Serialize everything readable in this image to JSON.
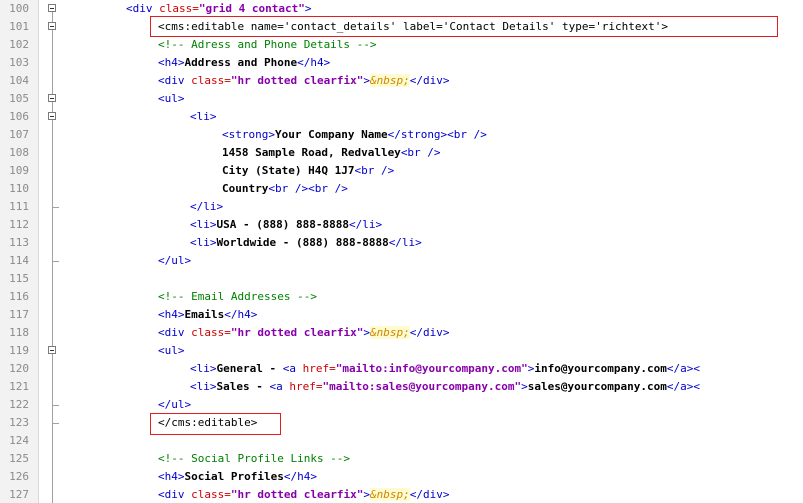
{
  "editor": {
    "lines": [
      {
        "num": "100",
        "indent": 0,
        "fold": "open",
        "parts": [
          {
            "t": "tag",
            "v": "<div "
          },
          {
            "t": "attr",
            "v": "class="
          },
          {
            "t": "val",
            "v": "\"grid 4 contact\""
          },
          {
            "t": "tag",
            "v": ">"
          }
        ]
      },
      {
        "num": "101",
        "indent": 1,
        "fold": "open",
        "parts": [
          {
            "t": "plain",
            "v": "<cms:editable name='contact_details' label='Contact Details' type='richtext'>"
          }
        ]
      },
      {
        "num": "102",
        "indent": 1,
        "parts": [
          {
            "t": "com",
            "v": "<!-- Adress and Phone Details -->"
          }
        ]
      },
      {
        "num": "103",
        "indent": 1,
        "parts": [
          {
            "t": "tag",
            "v": "<h4>"
          },
          {
            "t": "txt",
            "v": "Address and Phone"
          },
          {
            "t": "tag",
            "v": "</h4>"
          }
        ]
      },
      {
        "num": "104",
        "indent": 1,
        "parts": [
          {
            "t": "tag",
            "v": "<div "
          },
          {
            "t": "attr",
            "v": "class="
          },
          {
            "t": "val",
            "v": "\"hr dotted clearfix\""
          },
          {
            "t": "tag",
            "v": ">"
          },
          {
            "t": "ent",
            "v": "&nbsp;"
          },
          {
            "t": "tag",
            "v": "</div>"
          }
        ]
      },
      {
        "num": "105",
        "indent": 1,
        "fold": "open",
        "parts": [
          {
            "t": "tag",
            "v": "<ul>"
          }
        ]
      },
      {
        "num": "106",
        "indent": 2,
        "fold": "open",
        "parts": [
          {
            "t": "tag",
            "v": "<li>"
          }
        ]
      },
      {
        "num": "107",
        "indent": 3,
        "parts": [
          {
            "t": "tag",
            "v": "<strong>"
          },
          {
            "t": "txt",
            "v": "Your Company Name"
          },
          {
            "t": "tag",
            "v": "</strong><br />"
          }
        ]
      },
      {
        "num": "108",
        "indent": 3,
        "parts": [
          {
            "t": "txt",
            "v": "1458 Sample Road, Redvalley"
          },
          {
            "t": "tag",
            "v": "<br />"
          }
        ]
      },
      {
        "num": "109",
        "indent": 3,
        "parts": [
          {
            "t": "txt",
            "v": "City (State) H4Q 1J7"
          },
          {
            "t": "tag",
            "v": "<br />"
          }
        ]
      },
      {
        "num": "110",
        "indent": 3,
        "parts": [
          {
            "t": "txt",
            "v": "Country"
          },
          {
            "t": "tag",
            "v": "<br /><br />"
          }
        ]
      },
      {
        "num": "111",
        "indent": 2,
        "fold": "end",
        "parts": [
          {
            "t": "tag",
            "v": "</li>"
          }
        ]
      },
      {
        "num": "112",
        "indent": 2,
        "parts": [
          {
            "t": "tag",
            "v": "<li>"
          },
          {
            "t": "txt",
            "v": "USA - (888) 888-8888"
          },
          {
            "t": "tag",
            "v": "</li>"
          }
        ]
      },
      {
        "num": "113",
        "indent": 2,
        "parts": [
          {
            "t": "tag",
            "v": "<li>"
          },
          {
            "t": "txt",
            "v": "Worldwide - (888) 888-8888"
          },
          {
            "t": "tag",
            "v": "</li>"
          }
        ]
      },
      {
        "num": "114",
        "indent": 1,
        "fold": "end",
        "parts": [
          {
            "t": "tag",
            "v": "</ul>"
          }
        ]
      },
      {
        "num": "115",
        "indent": 0,
        "parts": []
      },
      {
        "num": "116",
        "indent": 1,
        "parts": [
          {
            "t": "com",
            "v": "<!-- Email Addresses -->"
          }
        ]
      },
      {
        "num": "117",
        "indent": 1,
        "parts": [
          {
            "t": "tag",
            "v": "<h4>"
          },
          {
            "t": "txt",
            "v": "Emails"
          },
          {
            "t": "tag",
            "v": "</h4>"
          }
        ]
      },
      {
        "num": "118",
        "indent": 1,
        "parts": [
          {
            "t": "tag",
            "v": "<div "
          },
          {
            "t": "attr",
            "v": "class="
          },
          {
            "t": "val",
            "v": "\"hr dotted clearfix\""
          },
          {
            "t": "tag",
            "v": ">"
          },
          {
            "t": "ent",
            "v": "&nbsp;"
          },
          {
            "t": "tag",
            "v": "</div>"
          }
        ]
      },
      {
        "num": "119",
        "indent": 1,
        "fold": "open",
        "parts": [
          {
            "t": "tag",
            "v": "<ul>"
          }
        ]
      },
      {
        "num": "120",
        "indent": 2,
        "parts": [
          {
            "t": "tag",
            "v": "<li>"
          },
          {
            "t": "txt",
            "v": "General - "
          },
          {
            "t": "tag",
            "v": "<a "
          },
          {
            "t": "attr",
            "v": "href="
          },
          {
            "t": "val",
            "v": "\"mailto:info@yourcompany.com\""
          },
          {
            "t": "tag",
            "v": ">"
          },
          {
            "t": "txt",
            "v": "info@yourcompany.com"
          },
          {
            "t": "tag",
            "v": "</a><"
          }
        ]
      },
      {
        "num": "121",
        "indent": 2,
        "parts": [
          {
            "t": "tag",
            "v": "<li>"
          },
          {
            "t": "txt",
            "v": "Sales - "
          },
          {
            "t": "tag",
            "v": "<a "
          },
          {
            "t": "attr",
            "v": "href="
          },
          {
            "t": "val",
            "v": "\"mailto:sales@yourcompany.com\""
          },
          {
            "t": "tag",
            "v": ">"
          },
          {
            "t": "txt",
            "v": "sales@yourcompany.com"
          },
          {
            "t": "tag",
            "v": "</a><"
          }
        ]
      },
      {
        "num": "122",
        "indent": 1,
        "fold": "end",
        "parts": [
          {
            "t": "tag",
            "v": "</ul>"
          }
        ]
      },
      {
        "num": "123",
        "indent": 1,
        "fold": "end",
        "parts": [
          {
            "t": "plain",
            "v": "</cms:editable>"
          }
        ]
      },
      {
        "num": "124",
        "indent": 0,
        "parts": []
      },
      {
        "num": "125",
        "indent": 1,
        "parts": [
          {
            "t": "com",
            "v": "<!-- Social Profile Links -->"
          }
        ]
      },
      {
        "num": "126",
        "indent": 1,
        "parts": [
          {
            "t": "tag",
            "v": "<h4>"
          },
          {
            "t": "txt",
            "v": "Social Profiles"
          },
          {
            "t": "tag",
            "v": "</h4>"
          }
        ]
      },
      {
        "num": "127",
        "indent": 1,
        "parts": [
          {
            "t": "tag",
            "v": "<div "
          },
          {
            "t": "attr",
            "v": "class="
          },
          {
            "t": "val",
            "v": "\"hr dotted clearfix\""
          },
          {
            "t": "tag",
            "v": ">"
          },
          {
            "t": "ent",
            "v": "&nbsp;"
          },
          {
            "t": "tag",
            "v": "</div>"
          }
        ]
      }
    ],
    "highlight_color": "#e02020"
  }
}
